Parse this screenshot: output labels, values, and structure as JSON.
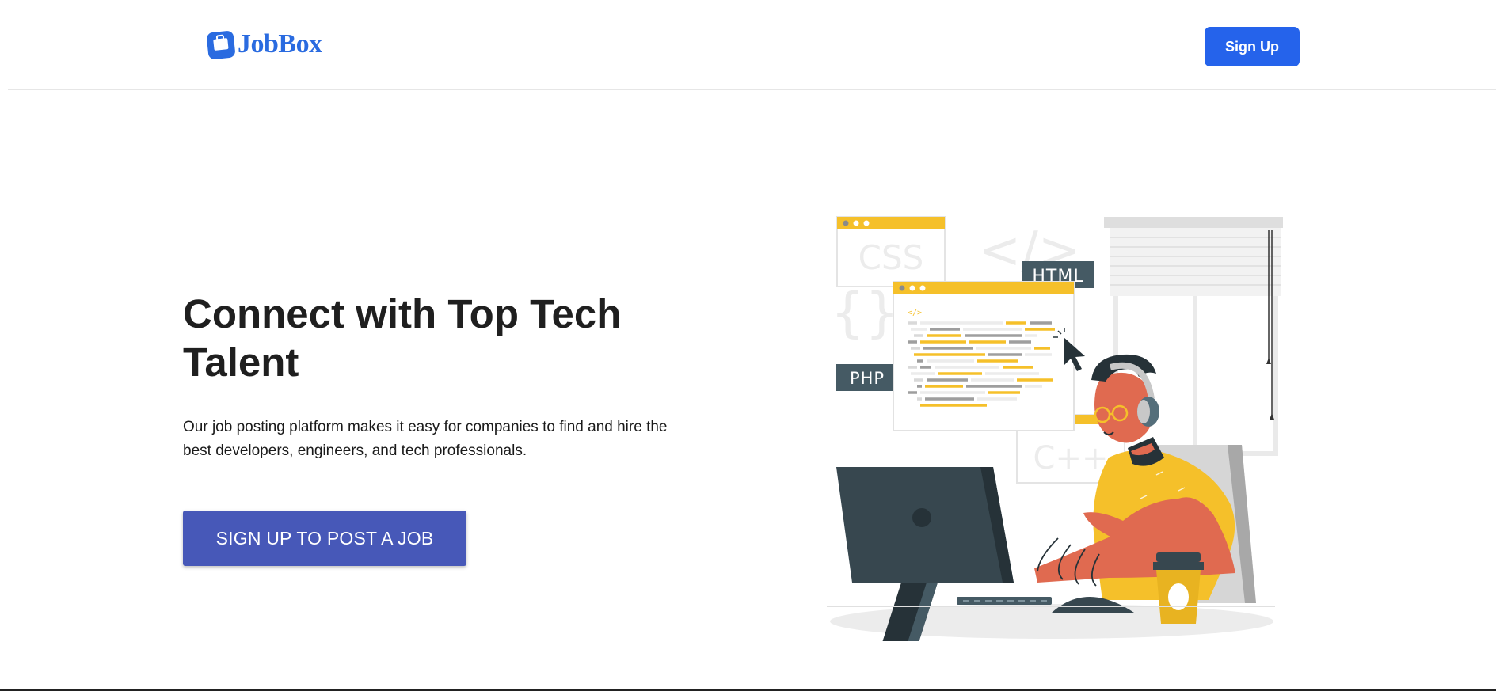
{
  "brand": {
    "name": "JobBox",
    "icon": "briefcase-icon",
    "color": "#2a6be0"
  },
  "nav": {
    "signup_label": "Sign Up",
    "signup_color": "#2563eb"
  },
  "hero": {
    "title": "Connect with Top Tech Talent",
    "description": "Our job posting platform makes it easy for companies to find and hire the best developers, engineers, and tech professionals.",
    "cta_label": "SIGN UP TO POST A JOB",
    "cta_color": "#4758b8"
  },
  "illustration": {
    "labels": {
      "css": "CSS",
      "html": "HTML",
      "php": "PHP",
      "cpp": "C++",
      "code_tag": "</>",
      "braces": "{}"
    },
    "accent": "#f5c02a",
    "skin": "#e06a50",
    "dark": "#37474f"
  }
}
